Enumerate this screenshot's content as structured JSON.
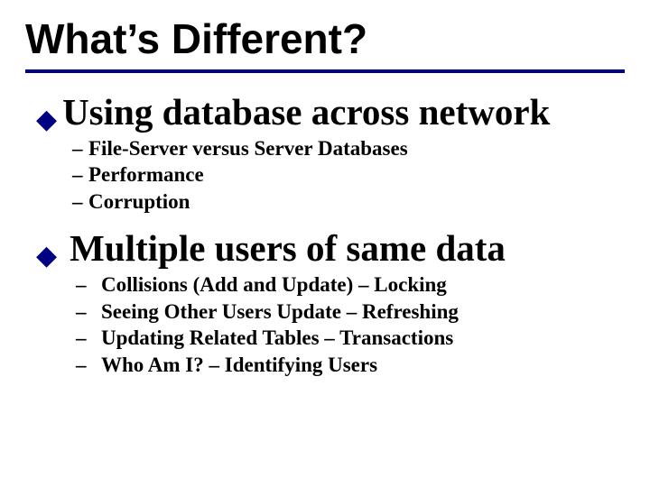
{
  "title": "What’s Different?",
  "section1": {
    "heading": "Using  database across network",
    "items": [
      "File-Server versus Server Databases",
      "Performance",
      "Corruption"
    ]
  },
  "section2": {
    "heading": "Multiple users of same data",
    "items": [
      "Collisions (Add and Update) – Locking",
      "Seeing Other Users Update – Refreshing",
      "Updating Related Tables – Transactions",
      "Who Am I? – Identifying Users"
    ]
  }
}
